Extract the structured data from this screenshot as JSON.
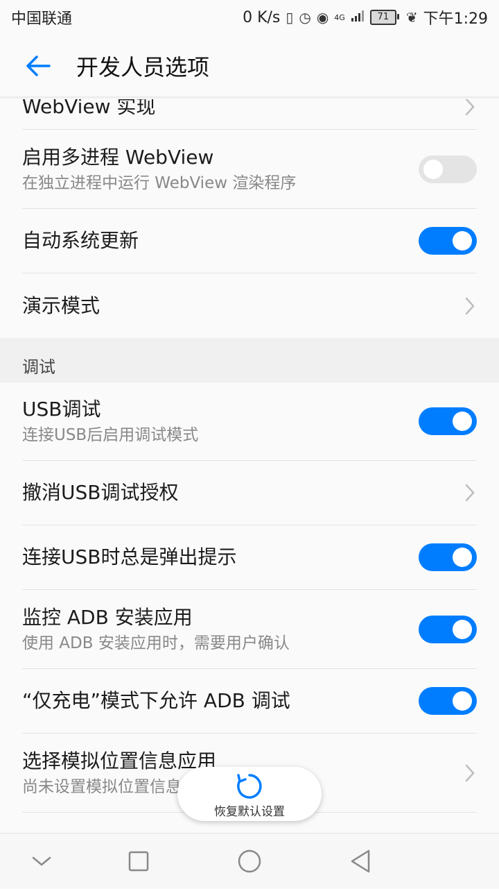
{
  "status_bar": {
    "carrier": "中国联通",
    "speed": "0 K/s",
    "network": "4G",
    "battery": "71",
    "time": "下午1:29"
  },
  "header": {
    "title": "开发人员选项",
    "back_icon": "arrow-left-icon"
  },
  "rows": [
    {
      "title": "WebView 实现",
      "control": "chevron"
    },
    {
      "title": "启用多进程 WebView",
      "subtitle": "在独立进程中运行 WebView 渲染程序",
      "control": "switch",
      "on": false
    },
    {
      "title": "自动系统更新",
      "control": "switch",
      "on": true
    },
    {
      "title": "演示模式",
      "control": "chevron"
    }
  ],
  "section": {
    "title": "调试"
  },
  "debug_rows": [
    {
      "title": "USB调试",
      "subtitle": "连接USB后启用调试模式",
      "control": "switch",
      "on": true
    },
    {
      "title": "撤消USB调试授权",
      "control": "chevron"
    },
    {
      "title": "连接USB时总是弹出提示",
      "control": "switch",
      "on": true
    },
    {
      "title": "监控 ADB 安装应用",
      "subtitle": "使用 ADB 安装应用时，需要用户确认",
      "control": "switch",
      "on": true
    },
    {
      "title": "“仅充电”模式下允许 ADB 调试",
      "control": "switch",
      "on": true
    },
    {
      "title": "选择模拟位置信息应用",
      "subtitle": "尚未设置模拟位置信息应用",
      "control": "chevron"
    }
  ],
  "reset_button": {
    "label": "恢复默认设置",
    "icon": "refresh-icon"
  },
  "nav_bar": {
    "icons": [
      "chevron-down-icon",
      "square-icon",
      "circle-icon",
      "triangle-back-icon"
    ]
  },
  "colors": {
    "accent": "#007dff",
    "switch_off": "#e4e4e4",
    "section_bg": "#f0f0f0"
  }
}
